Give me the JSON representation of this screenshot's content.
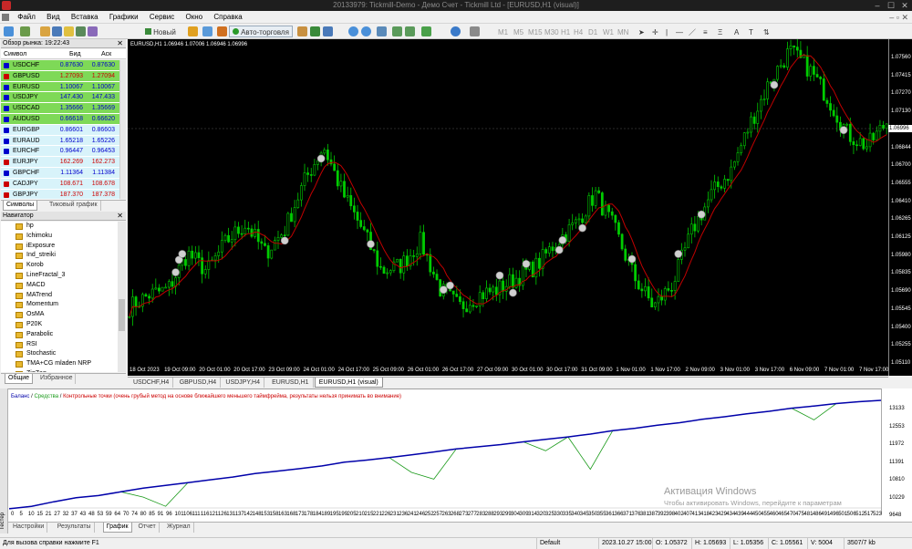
{
  "window": {
    "title": "20133979: Tickmill-Demo - Демо Счет - Tickmill Ltd - [EURUSD,H1 (visual)]"
  },
  "menu": [
    "Файл",
    "Вид",
    "Вставка",
    "Графики",
    "Сервис",
    "Окно",
    "Справка"
  ],
  "toolbar": {
    "new_order": "Новый ордер",
    "auto_trading": "Авто-торговля",
    "timeframes": [
      "M1",
      "M5",
      "M15",
      "M30",
      "H1",
      "H4",
      "D1",
      "W1",
      "MN"
    ]
  },
  "market_watch": {
    "header": "Обзор рынка: 19:22:43",
    "columns": {
      "symbol": "Символ",
      "bid": "Бид",
      "ask": "Аск"
    },
    "rows": [
      {
        "symbol": "USDCHF",
        "bid": "0.87630",
        "ask": "0.87630",
        "bg": "#7ed957",
        "color": "#0000cc"
      },
      {
        "symbol": "GBPUSD",
        "bid": "1.27093",
        "ask": "1.27094",
        "bg": "#7ed957",
        "color": "#cc0000"
      },
      {
        "symbol": "EURUSD",
        "bid": "1.10067",
        "ask": "1.10067",
        "bg": "#7ed957",
        "color": "#0000cc"
      },
      {
        "symbol": "USDJPY",
        "bid": "147.430",
        "ask": "147.433",
        "bg": "#7ed957",
        "color": "#0000cc"
      },
      {
        "symbol": "USDCAD",
        "bid": "1.35666",
        "ask": "1.35669",
        "bg": "#7ed957",
        "color": "#0000cc"
      },
      {
        "symbol": "AUDUSD",
        "bid": "0.66618",
        "ask": "0.66620",
        "bg": "#7ed957",
        "color": "#0000cc"
      },
      {
        "symbol": "EURGBP",
        "bid": "0.86601",
        "ask": "0.86603",
        "bg": "#d8f3fa",
        "color": "#0000cc"
      },
      {
        "symbol": "EURAUD",
        "bid": "1.65218",
        "ask": "1.65226",
        "bg": "#d8f3fa",
        "color": "#0000cc"
      },
      {
        "symbol": "EURCHF",
        "bid": "0.96447",
        "ask": "0.96453",
        "bg": "#d8f3fa",
        "color": "#0000cc"
      },
      {
        "symbol": "EURJPY",
        "bid": "162.269",
        "ask": "162.273",
        "bg": "#d8f3fa",
        "color": "#cc0000"
      },
      {
        "symbol": "GBPCHF",
        "bid": "1.11364",
        "ask": "1.11384",
        "bg": "#d8f3fa",
        "color": "#0000cc"
      },
      {
        "symbol": "CADJPY",
        "bid": "108.671",
        "ask": "108.678",
        "bg": "#d8f3fa",
        "color": "#cc0000"
      },
      {
        "symbol": "GBPJPY",
        "bid": "187.370",
        "ask": "187.378",
        "bg": "#d8f3fa",
        "color": "#cc0000"
      }
    ],
    "tabs": [
      "Символы",
      "Тиковый график"
    ]
  },
  "navigator": {
    "header": "Навигатор",
    "items": [
      "hp",
      "Ichimoku",
      "iExposure",
      "Ind_streiki",
      "Korob",
      "LineFractal_3",
      "MACD",
      "MATrend",
      "Momentum",
      "OsMA",
      "P20K",
      "Parabolic",
      "RSI",
      "Stochastic",
      "TMA+CG mladen NRP",
      "ZigZag"
    ],
    "tabs": [
      "Общие",
      "Избранное"
    ]
  },
  "chart": {
    "label": "EURUSD,H1  1.06946 1.07006 1.06946 1.06996",
    "current_price": "1.06996",
    "price_levels": [
      "1.07560",
      "1.07415",
      "1.07270",
      "1.07130",
      "1.06996",
      "1.06844",
      "1.06700",
      "1.06555",
      "1.06410",
      "1.06265",
      "1.06125",
      "1.05980",
      "1.05835",
      "1.05690",
      "1.05545",
      "1.05400",
      "1.05255",
      "1.05110"
    ],
    "time_labels": [
      "18 Oct 2023",
      "19 Oct 09:00",
      "20 Oct 01:00",
      "20 Oct 17:00",
      "23 Oct 09:00",
      "24 Oct 01:00",
      "24 Oct 17:00",
      "25 Oct 09:00",
      "26 Oct 01:00",
      "26 Oct 17:00",
      "27 Oct 09:00",
      "30 Oct 01:00",
      "30 Oct 17:00",
      "31 Oct 09:00",
      "1 Nov 01:00",
      "1 Nov 17:00",
      "2 Nov 09:00",
      "3 Nov 01:00",
      "3 Nov 17:00",
      "6 Nov 09:00",
      "7 Nov 01:00",
      "7 Nov 17:00"
    ],
    "tabs": [
      "USDCHF,H4",
      "GBPUSD,H4",
      "USDJPY,H4",
      "EURUSD,H1",
      "EURUSD,H1 (visual)"
    ],
    "active_tab": 4
  },
  "tester": {
    "side_label": "Тестер",
    "legend_balance": "Баланс",
    "legend_equity": "Средства",
    "legend_warning": "Контрольные точки (очень грубый метод на основе ближайшего меньшего таймфрейма, результаты нельзя принимать во внимание)",
    "y_labels": [
      "13133",
      "12553",
      "11972",
      "11391",
      "10810",
      "10229",
      "9648"
    ],
    "x_labels": [
      "0",
      "5",
      "10",
      "15",
      "21",
      "27",
      "32",
      "37",
      "43",
      "48",
      "53",
      "59",
      "64",
      "70",
      "74",
      "80",
      "85",
      "91",
      "96",
      "101",
      "106",
      "111",
      "116",
      "121",
      "126",
      "131",
      "137",
      "142",
      "148",
      "153",
      "158",
      "163",
      "168",
      "173",
      "178",
      "184",
      "189",
      "195",
      "199",
      "205",
      "210",
      "215",
      "221",
      "226",
      "231",
      "236",
      "241",
      "246",
      "252",
      "257",
      "263",
      "268",
      "273",
      "277",
      "283",
      "288",
      "293",
      "299",
      "304",
      "309",
      "314",
      "320",
      "325",
      "330",
      "335",
      "340",
      "345",
      "350",
      "355",
      "361",
      "366",
      "371",
      "376",
      "381",
      "387",
      "392",
      "398",
      "402",
      "407",
      "413",
      "418",
      "423",
      "429",
      "434",
      "439",
      "444",
      "450",
      "455",
      "460",
      "465",
      "470",
      "475",
      "481",
      "486",
      "491",
      "496",
      "501",
      "506",
      "512",
      "517",
      "523"
    ],
    "tabs": [
      "Настройки",
      "Результаты",
      "График",
      "Отчет",
      "Журнал"
    ],
    "active_tab": 2
  },
  "chart_data": {
    "type": "line",
    "series": [
      {
        "name": "Баланс",
        "color": "#0000aa",
        "values": [
          9620,
          9700,
          9850,
          9980,
          10050,
          10170,
          10290,
          10380,
          10470,
          10560,
          10650,
          10760,
          10840,
          10920,
          11010,
          11130,
          11200,
          11280,
          11370,
          11460,
          11560,
          11630,
          11700,
          11790,
          11870,
          11950,
          12040,
          12150,
          12230,
          12330,
          12410,
          12520,
          12600,
          12700,
          12780,
          12880,
          12950,
          13030,
          13090,
          13133
        ]
      },
      {
        "name": "Средства",
        "color": "#1a9a1a",
        "values": [
          9620,
          9700,
          9850,
          9980,
          10050,
          10170,
          10000,
          9700,
          10470,
          10560,
          10650,
          10760,
          10840,
          10920,
          11010,
          11130,
          11200,
          11280,
          10800,
          10580,
          11560,
          11630,
          11700,
          11790,
          11500,
          11950,
          10900,
          12150,
          12230,
          12330,
          12410,
          12520,
          12600,
          12700,
          12780,
          12880,
          12500,
          13030,
          13090,
          13133
        ]
      }
    ],
    "ylim": [
      9648,
      13133
    ],
    "xlim": [
      0,
      523
    ]
  },
  "status": {
    "help": "Для вызова справки нажмите F1",
    "profile": "Default",
    "datetime": "2023.10.27 15:00",
    "open": "O: 1.05372",
    "high": "H: 1.05693",
    "low": "L: 1.05356",
    "close": "C: 1.05561",
    "volume": "V: 5004",
    "traffic": "3507/7 kb"
  },
  "watermark": {
    "line1": "Активация Windows",
    "line2": "Чтобы активировать Windows, перейдите к параметрам"
  },
  "colors": {
    "bull_candle": "#00cc00",
    "bear_candle": "#00cc00",
    "ma": "#c00000",
    "background": "#000000"
  }
}
